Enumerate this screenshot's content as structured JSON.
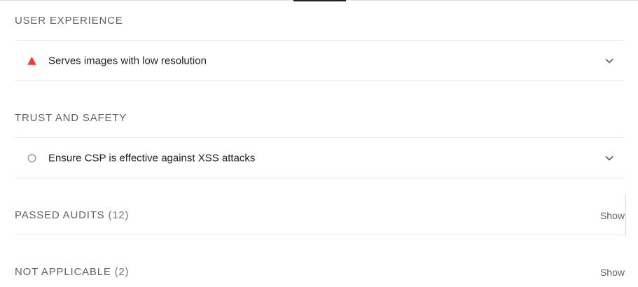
{
  "groups": {
    "user_experience": {
      "title": "USER EXPERIENCE",
      "audits": [
        {
          "title": "Serves images with low resolution",
          "status": "fail",
          "icon": "fail-triangle-icon",
          "color": "#ff3333"
        }
      ]
    },
    "trust_and_safety": {
      "title": "TRUST AND SAFETY",
      "audits": [
        {
          "title": "Ensure CSP is effective against XSS attacks",
          "status": "informative",
          "icon": "informative-circle-icon",
          "color": "#9e9e9e"
        }
      ]
    },
    "passed_audits": {
      "title": "PASSED AUDITS",
      "count": "(12)",
      "action": "Show"
    },
    "not_applicable": {
      "title": "NOT APPLICABLE",
      "count": "(2)",
      "action": "Show"
    }
  },
  "colors": {
    "fail": "#ff3333",
    "neutral_icon": "#9e9e9e",
    "text": "#212121",
    "muted": "#5f6368",
    "divider": "#ebebeb"
  }
}
